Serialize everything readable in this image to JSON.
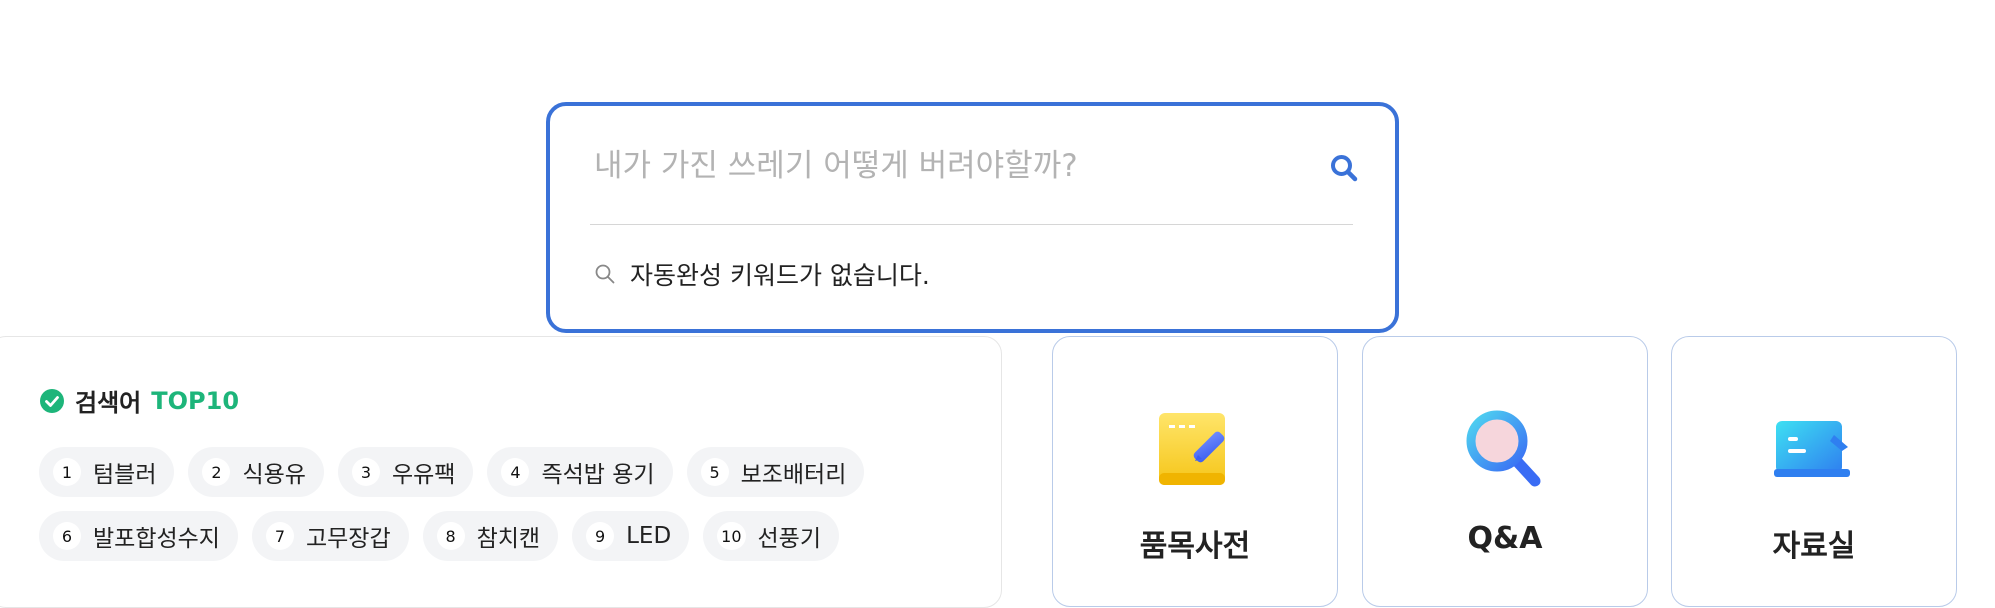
{
  "search": {
    "placeholder": "내가 가진 쓰레기 어떻게 버려야할까?",
    "value": "",
    "autocomplete_message": "자동완성 키워드가 없습니다."
  },
  "top10": {
    "heading_prefix": "검색어",
    "heading_accent": "TOP10",
    "items": [
      {
        "rank": "1",
        "label": "텀블러"
      },
      {
        "rank": "2",
        "label": "식용유"
      },
      {
        "rank": "3",
        "label": "우유팩"
      },
      {
        "rank": "4",
        "label": "즉석밥 용기"
      },
      {
        "rank": "5",
        "label": "보조배터리"
      },
      {
        "rank": "6",
        "label": "발포합성수지"
      },
      {
        "rank": "7",
        "label": "고무장갑"
      },
      {
        "rank": "8",
        "label": "참치캔"
      },
      {
        "rank": "9",
        "label": "LED"
      },
      {
        "rank": "10",
        "label": "선풍기"
      }
    ]
  },
  "cards": [
    {
      "title": "품목사전",
      "icon": "dictionary-icon"
    },
    {
      "title": "Q&A",
      "icon": "magnifier-icon"
    },
    {
      "title": "자료실",
      "icon": "archive-icon"
    }
  ],
  "colors": {
    "accent_blue": "#3a72d8",
    "accent_green": "#1db57a"
  }
}
